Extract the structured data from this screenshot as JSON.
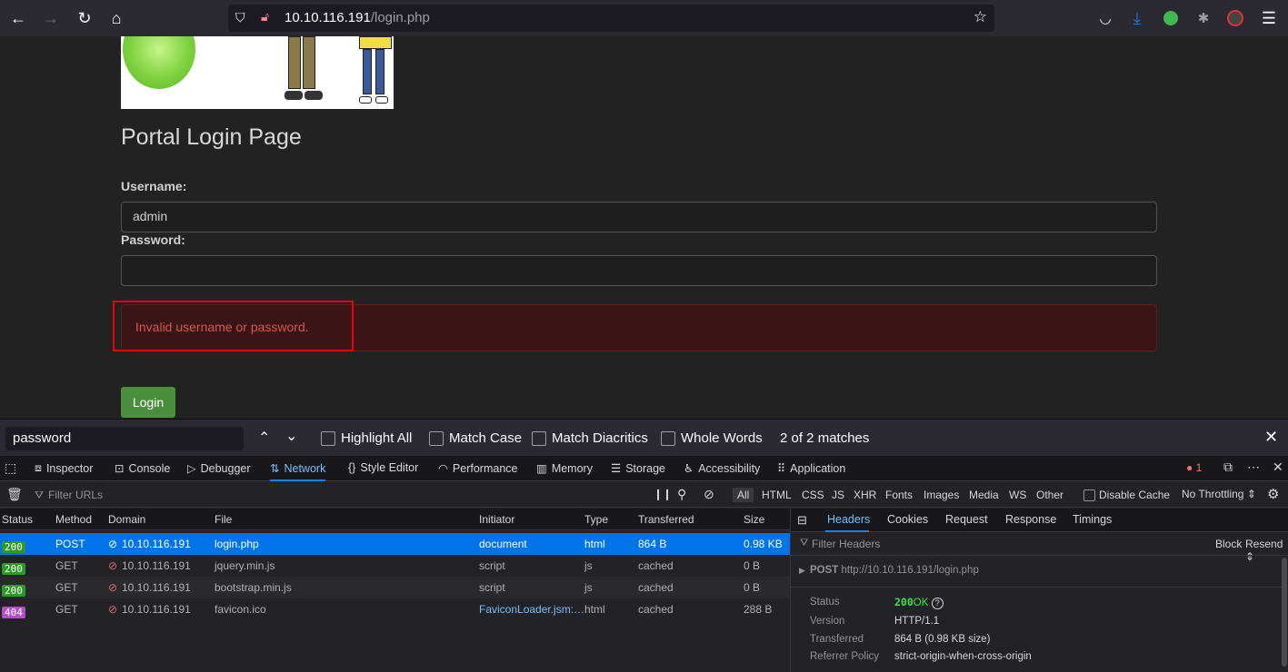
{
  "browser": {
    "url_host": "10.10.116.191",
    "url_path": "/login.php"
  },
  "page": {
    "title": "Portal Login Page",
    "username_label": "Username:",
    "username_value": "admin",
    "password_label": "Password:",
    "error": "Invalid username or password.",
    "login_button": "Login"
  },
  "findbar": {
    "query": "password",
    "highlight_all": "Highlight All",
    "match_case": "Match Case",
    "match_diacritics": "Match Diacritics",
    "whole_words": "Whole Words",
    "matches": "2 of 2 matches"
  },
  "devtools": {
    "tabs": [
      "Inspector",
      "Console",
      "Debugger",
      "Network",
      "Style Editor",
      "Performance",
      "Memory",
      "Storage",
      "Accessibility",
      "Application"
    ],
    "error_count": "1",
    "filter_placeholder": "Filter URLs",
    "type_filters": [
      "All",
      "HTML",
      "CSS",
      "JS",
      "XHR",
      "Fonts",
      "Images",
      "Media",
      "WS",
      "Other"
    ],
    "disable_cache": "Disable Cache",
    "throttling": "No Throttling",
    "columns": [
      "Status",
      "Method",
      "Domain",
      "File",
      "Initiator",
      "Type",
      "Transferred",
      "Size"
    ],
    "requests": [
      {
        "status": "200",
        "method": "POST",
        "domain": "10.10.116.191",
        "file": "login.php",
        "initiator": "document",
        "type": "html",
        "transferred": "864 B",
        "size": "0.98 KB"
      },
      {
        "status": "200",
        "method": "GET",
        "domain": "10.10.116.191",
        "file": "jquery.min.js",
        "initiator": "script",
        "type": "js",
        "transferred": "cached",
        "size": "0 B"
      },
      {
        "status": "200",
        "method": "GET",
        "domain": "10.10.116.191",
        "file": "bootstrap.min.js",
        "initiator": "script",
        "type": "js",
        "transferred": "cached",
        "size": "0 B"
      },
      {
        "status": "404",
        "method": "GET",
        "domain": "10.10.116.191",
        "file": "favicon.ico",
        "initiator": "FaviconLoader.jsm:…",
        "type": "html",
        "transferred": "cached",
        "size": "288 B"
      }
    ],
    "panel_tabs": [
      "Headers",
      "Cookies",
      "Request",
      "Response",
      "Timings"
    ],
    "filter_headers": "Filter Headers",
    "block": "Block",
    "resend": "Resend",
    "request_method": "POST",
    "request_url": "http://10.10.116.191/login.php",
    "details": {
      "status_label": "Status",
      "status_code": "200",
      "status_text": "OK",
      "version_label": "Version",
      "version": "HTTP/1.1",
      "transferred_label": "Transferred",
      "transferred": "864 B (0.98 KB size)",
      "referrer_label": "Referrer Policy",
      "referrer": "strict-origin-when-cross-origin"
    }
  }
}
